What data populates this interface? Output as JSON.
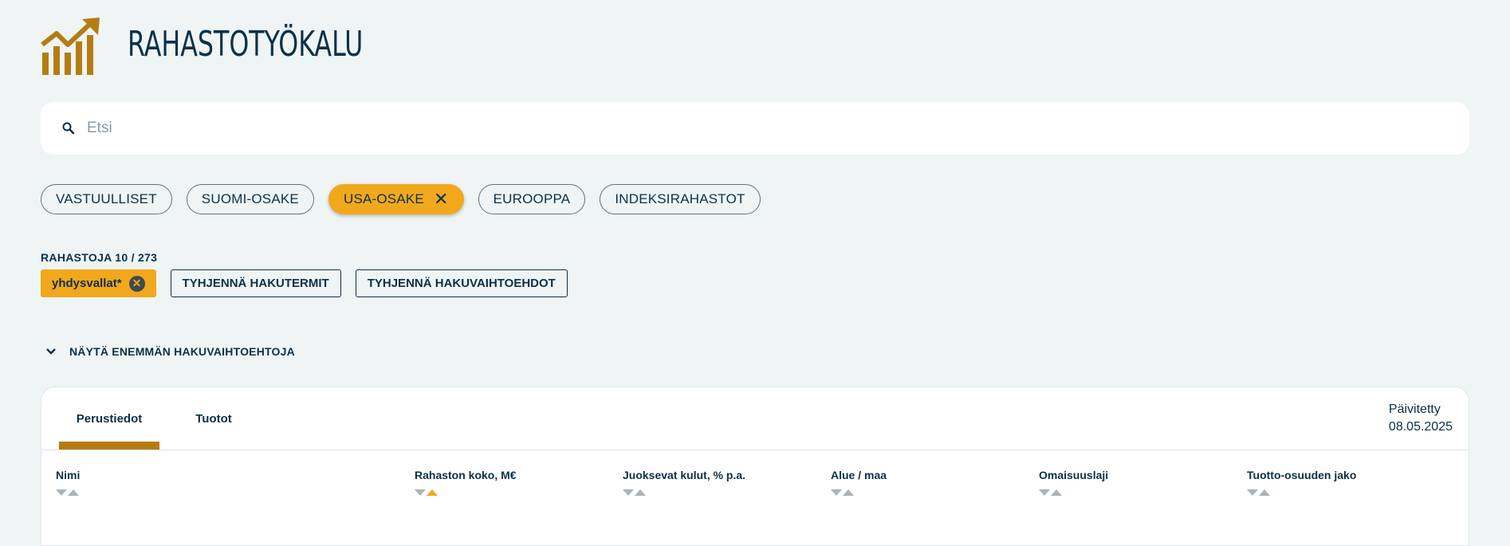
{
  "app": {
    "title": "RAHASTOTYÖKALU"
  },
  "search": {
    "placeholder": "Etsi",
    "value": ""
  },
  "chips": [
    {
      "label": "VASTUULLISET",
      "active": false
    },
    {
      "label": "SUOMI-OSAKE",
      "active": false
    },
    {
      "label": "USA-OSAKE",
      "active": true
    },
    {
      "label": "EUROOPPA",
      "active": false
    },
    {
      "label": "INDEKSIRAHASTOT",
      "active": false
    }
  ],
  "results": {
    "count_label": "RAHASTOJA 10 / 273"
  },
  "active_terms": [
    {
      "label": "yhdysvallat*"
    }
  ],
  "actions": {
    "clear_terms": "TYHJENNÄ HAKUTERMIT",
    "clear_options": "TYHJENNÄ HAKUVAIHTOEHDOT"
  },
  "more_options": {
    "label": "NÄYTÄ ENEMMÄN HAKUVAIHTOEHTOJA"
  },
  "panel": {
    "tabs": [
      {
        "label": "Perustiedot",
        "selected": true
      },
      {
        "label": "Tuotot",
        "selected": false
      }
    ],
    "updated_label": "Päivitetty",
    "updated_date": "08.05.2025",
    "columns": [
      {
        "label": "Nimi",
        "sort": "none"
      },
      {
        "label": "Rahaston koko, M€",
        "sort": "asc"
      },
      {
        "label": "Juoksevat kulut, % p.a.",
        "sort": "none"
      },
      {
        "label": "Alue / maa",
        "sort": "none"
      },
      {
        "label": "Omaisuuslaji",
        "sort": "none"
      },
      {
        "label": "Tuotto-osuuden jako",
        "sort": "none"
      }
    ]
  },
  "colors": {
    "accent": "#f2a81d",
    "brand": "#b57c12",
    "text": "#0b3147",
    "background": "#eff4f4"
  },
  "icons": {
    "logo": "growth-chart-icon",
    "search": "search-icon",
    "expand": "chevron-down-icon"
  }
}
